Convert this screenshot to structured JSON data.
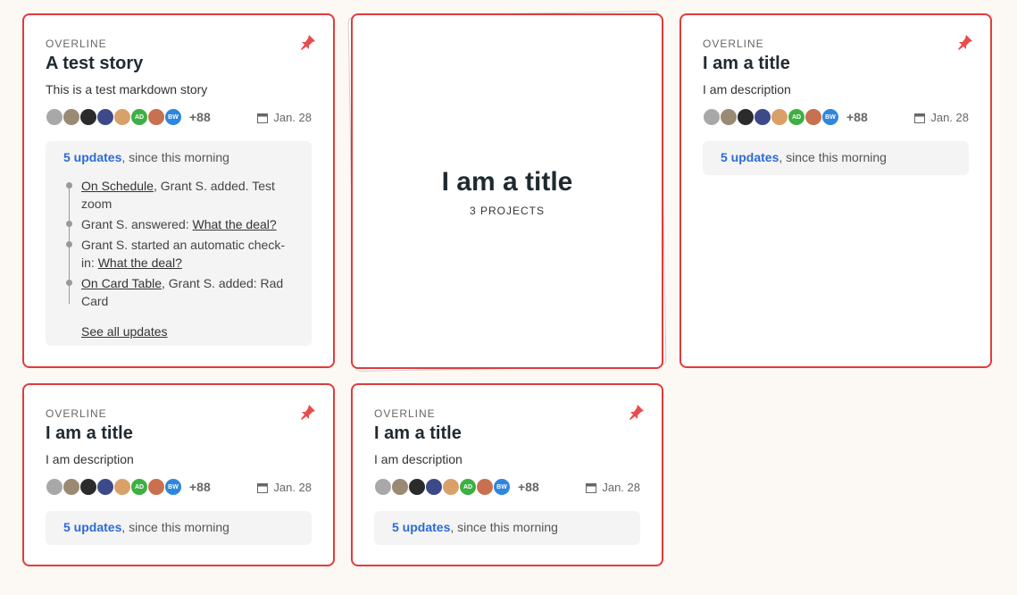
{
  "accent": "#e23b3b",
  "link_color": "#2c6bd6",
  "cards": [
    {
      "overline": "OVERLINE",
      "title": "A test story",
      "description": "This is a test markdown story",
      "avatars_more": "+88",
      "date": "Jan. 28",
      "updates_count": "5 updates",
      "updates_since": ", since this morning",
      "timeline": [
        {
          "link": "On Schedule",
          "text": ", Grant S. added. Test zoom"
        },
        {
          "pre": "Grant S. answered: ",
          "link": "What the deal?"
        },
        {
          "pre": "Grant S. started an automatic check-in: ",
          "link": "What the deal?"
        },
        {
          "link": "On Card Table",
          "text": ", Grant S. added: Rad Card"
        }
      ],
      "see_all": "See all updates"
    },
    {
      "title": "I am a title",
      "subtitle": "3 PROJECTS"
    },
    {
      "overline": "OVERLINE",
      "title": "I am a title",
      "description": "I am description",
      "avatars_more": "+88",
      "date": "Jan. 28",
      "updates_count": "5 updates",
      "updates_since": ", since this morning"
    },
    {
      "overline": "OVERLINE",
      "title": "I am a title",
      "description": "I am description",
      "avatars_more": "+88",
      "date": "Jan. 28",
      "updates_count": "5 updates",
      "updates_since": ", since this morning"
    },
    {
      "overline": "OVERLINE",
      "title": "I am a title",
      "description": "I am description",
      "avatars_more": "+88",
      "date": "Jan. 28",
      "updates_count": "5 updates",
      "updates_since": ", since this morning"
    }
  ],
  "avatars": [
    {
      "icon": "person-photo-icon",
      "color": "#a8a8a8"
    },
    {
      "icon": "person-photo-icon",
      "color": "#9b8a73"
    },
    {
      "icon": "person-photo-icon",
      "color": "#2b2b2b"
    },
    {
      "icon": "person-photo-icon",
      "color": "#3d4a8a"
    },
    {
      "icon": "person-photo-icon",
      "color": "#d9a06a"
    },
    {
      "initials": "AD",
      "color": "#3cb043"
    },
    {
      "icon": "person-photo-icon",
      "color": "#c8704f"
    },
    {
      "initials": "BW",
      "color": "#2e86de"
    }
  ]
}
